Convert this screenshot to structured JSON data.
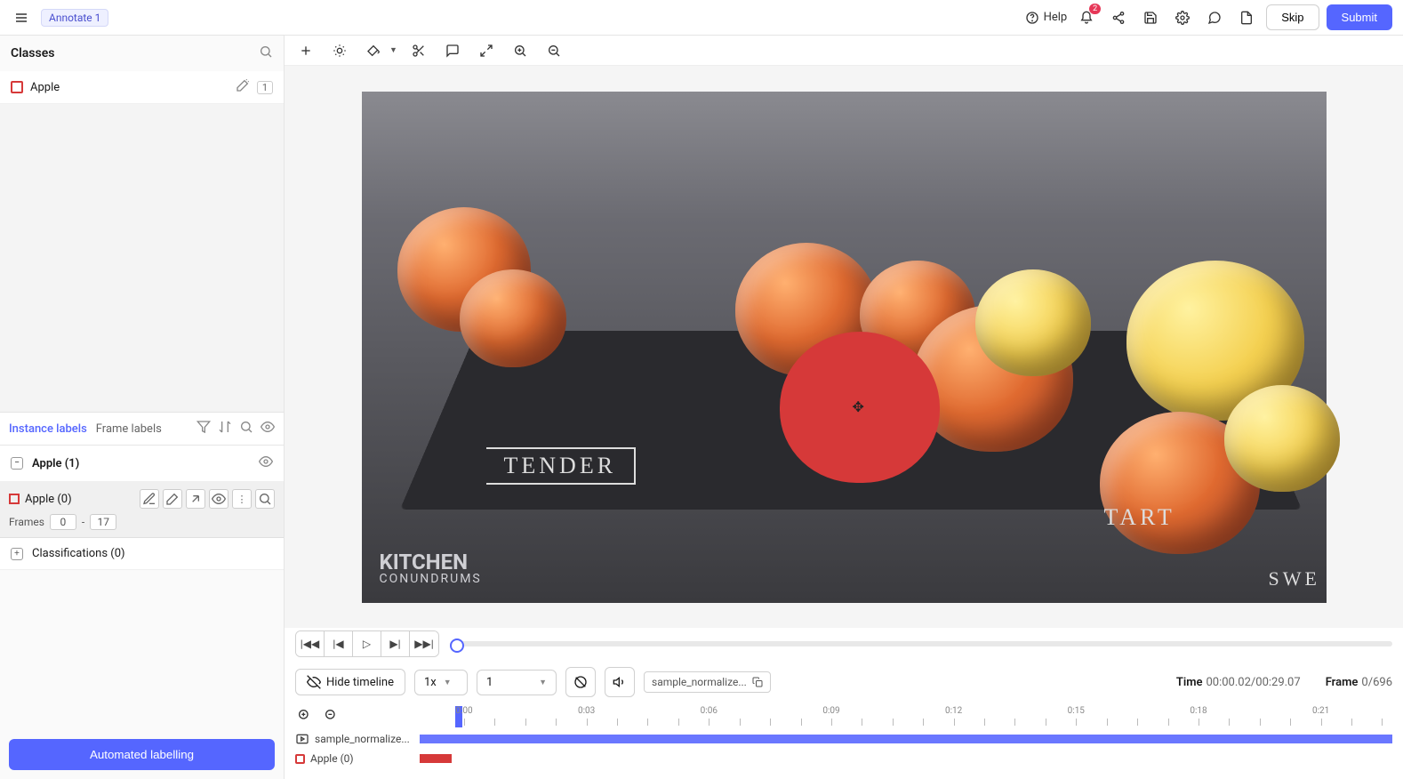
{
  "top": {
    "annotate_chip": "Annotate 1",
    "help": "Help",
    "notif_count": "2",
    "skip": "Skip",
    "submit": "Submit"
  },
  "sidebar": {
    "classes_title": "Classes",
    "class_name": "Apple",
    "class_shortcut": "1",
    "tab_instance": "Instance labels",
    "tab_frame": "Frame labels",
    "group_label": "Apple (1)",
    "instance_label": "Apple (0)",
    "frames_label": "Frames",
    "frame_from": "0",
    "frame_dash": "-",
    "frame_to": "17",
    "classifications": "Classifications (0)",
    "auto_label": "Automated labelling"
  },
  "canvas": {
    "chalk_tender": "TENDER",
    "chalk_tart": "TART",
    "chalk_swe": "SWE",
    "logo1": "KITCHEN",
    "logo2": "CONUNDRUMS"
  },
  "controls": {
    "hide_timeline": "Hide timeline",
    "speed": "1x",
    "step": "1",
    "clip_name": "sample_normalize...",
    "time_label": "Time",
    "time_val": "00:00.02/00:29.07",
    "frame_label": "Frame",
    "frame_val": "0/696"
  },
  "ruler": {
    "ticks": [
      "0:00",
      "0:03",
      "0:06",
      "0:09",
      "0:12",
      "0:15",
      "0:18",
      "0:21"
    ]
  },
  "tracks": {
    "video": "sample_normalize...",
    "apple": "Apple (0)"
  }
}
